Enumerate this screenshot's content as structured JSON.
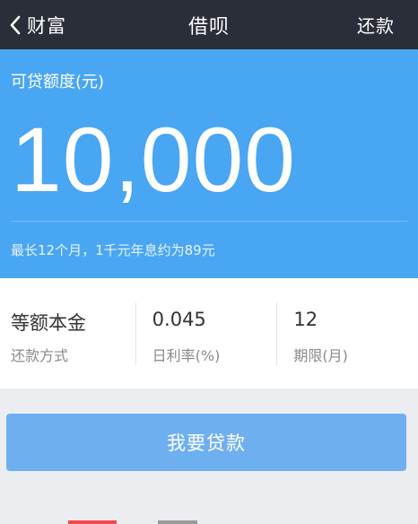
{
  "navbar": {
    "back_label": "财富",
    "title": "借呗",
    "right_action": "还款",
    "icon": "chevron-left-icon"
  },
  "hero": {
    "label": "可贷额度(元)",
    "amount": "10,000",
    "note": "最长12个月，1千元年息约为89元",
    "color": "#49a6f2"
  },
  "info": [
    {
      "value": "等额本金",
      "caption": "还款方式"
    },
    {
      "value": "0.045",
      "caption": "日利率(%)"
    },
    {
      "value": "12",
      "caption": "期限(月)"
    }
  ],
  "cta": {
    "label": "我要贷款",
    "color": "#6eaff0"
  }
}
